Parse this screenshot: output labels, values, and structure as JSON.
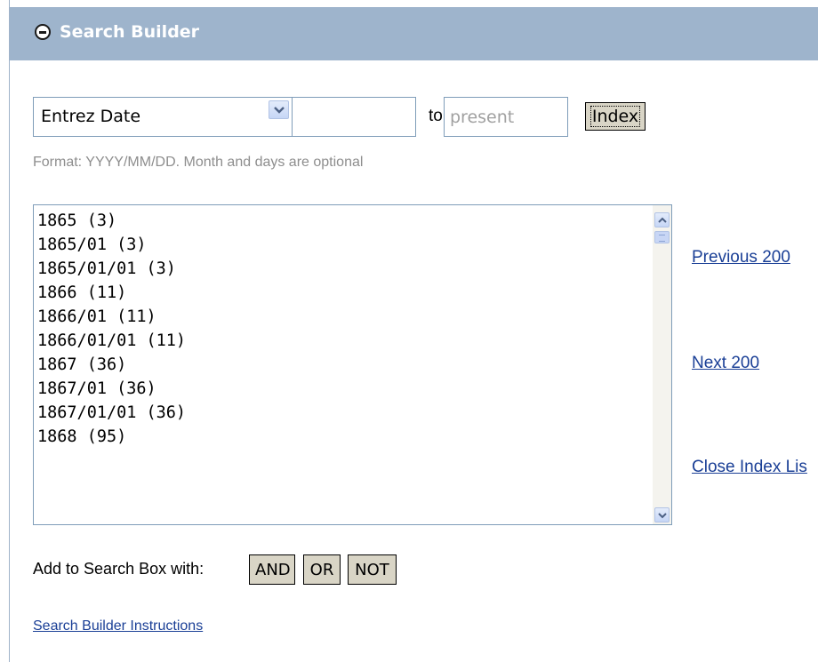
{
  "header": {
    "title": "Search Builder",
    "toggle_icon": "collapse-minus-icon"
  },
  "field_select": {
    "selected": "Entrez Date",
    "icon": "chevron-down-icon"
  },
  "date_range": {
    "from_value": "",
    "to_label": "to",
    "to_placeholder": "present"
  },
  "index_button": {
    "label": "Index"
  },
  "format_hint": "Format: YYYY/MM/DD. Month and days are optional",
  "index_list": {
    "items": [
      "1865 (3)",
      "1865/01 (3)",
      "1865/01/01 (3)",
      "1866 (11)",
      "1866/01 (11)",
      "1866/01/01 (11)",
      "1867 (36)",
      "1867/01 (36)",
      "1867/01/01 (36)",
      "1868 (95)"
    ]
  },
  "nav_links": {
    "previous": "Previous 200",
    "next": "Next 200",
    "close": "Close Index Lis"
  },
  "add_to_search": {
    "label": "Add to Search Box with:",
    "and": "AND",
    "or": "OR",
    "not": "NOT"
  },
  "instructions_link": "Search Builder Instructions",
  "colors": {
    "header_bg": "#9eb4cc",
    "link": "#1a3f96",
    "button_bg": "#d9d5c6",
    "hint": "#8e8e8e"
  }
}
